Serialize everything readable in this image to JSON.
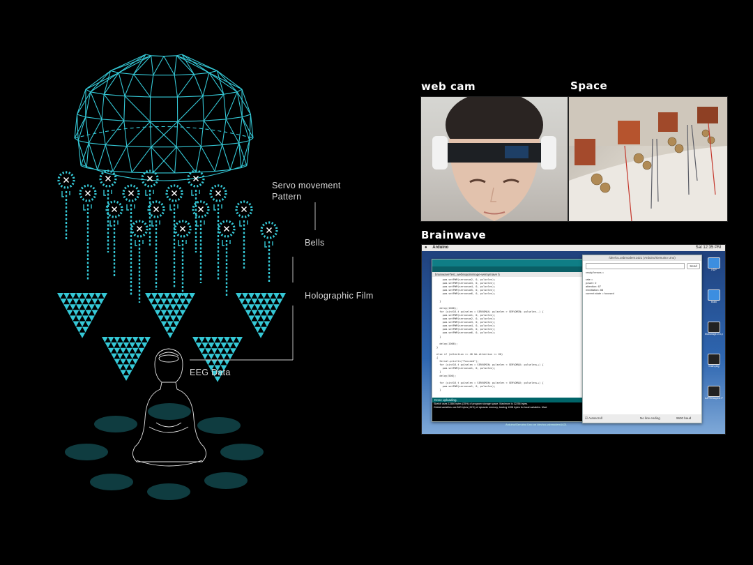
{
  "diagram": {
    "labels": {
      "servo": "Servo movement\nPattern",
      "bells": "Bells",
      "film": "Holographic Film",
      "eeg": "EEG Data"
    },
    "accent_color": "#35c8d6",
    "dish_color": "#0f3c40"
  },
  "panels": {
    "webcam_title": "web cam",
    "space_title": "Space",
    "brainwave_title": "Brainwave"
  },
  "screenshot": {
    "app_name": "Arduino",
    "clock": "Sat 12:35 PM",
    "ide_tab": "brainwaveTest_webinajoinimage-wemymave §",
    "serial_title": "/dev/cu.usbmodem1421 (Arduino/Genuino Uno)",
    "serial_button": "Send",
    "serial_lines": [
      "ready?errors =",
      "",
      "rate =",
      "power: 0",
      "attention: 67",
      "meditation: 88",
      "current state = focused"
    ],
    "code_lines": [
      "    pwm.setPWM(servonum2, 0, pulselen);",
      "    pwm.setPWM(servonum3, 0, pulselen);",
      "    pwm.setPWM(servonum4, 0, pulselen);",
      "    pwm.setPWM(servonum5, 0, pulselen);",
      "    pwm.setPWM(servonum6, 0, pulselen);",
      "",
      "  }",
      "",
      "  delay(1000);",
      "  for (uint16_t pulselen = SERVOMAX; pulselen > SERVOMIN; pulselen--) {",
      "    pwm.setPWM(servonum1, 0, pulselen);",
      "    pwm.setPWM(servonum2, 0, pulselen);",
      "    pwm.setPWM(servonum3, 0, pulselen);",
      "    pwm.setPWM(servonum4, 0, pulselen);",
      "    pwm.setPWM(servonum5, 0, pulselen);",
      "    pwm.setPWM(servonum6, 0, pulselen);",
      "  }",
      "",
      "  delay(1000);",
      "}",
      "",
      "else if (attention >= 40 && attention <= 60)",
      "{",
      "  Serial.println(\"Focused\");",
      "  for (uint16_t pulselen = SERVOMIN; pulselen < SERVOMAX; pulselen++) {",
      "    pwm.setPWM(servonum1, 0, pulselen);",
      "  }",
      "  delay(500);",
      "",
      "  for (uint16_t pulselen = SERVOMIN; pulselen < SERVOMAX; pulselen++) {",
      "    pwm.setPWM(servonum1, 0, pulselen);",
      "  }"
    ],
    "status_bar": "Done uploading.",
    "console_lines": [
      "Sketch uses 11586 bytes (35%) of program storage space. Maximum is 32256 bytes.",
      "Global variables use 840 bytes (41%) of dynamic memory, leaving 1208 bytes for local variables. Maxi"
    ],
    "footer": "Arduino/Genuino Uno on /dev/cu.usbmodem1421",
    "autoscroll": "Autoscroll",
    "line_ending": "No line ending",
    "baud": "9600 baud",
    "desktop_icons": [
      "HDP",
      "brain",
      "brainwage-0.5.pnb",
      "brain.png",
      "AJPEGaspect PO0"
    ]
  }
}
